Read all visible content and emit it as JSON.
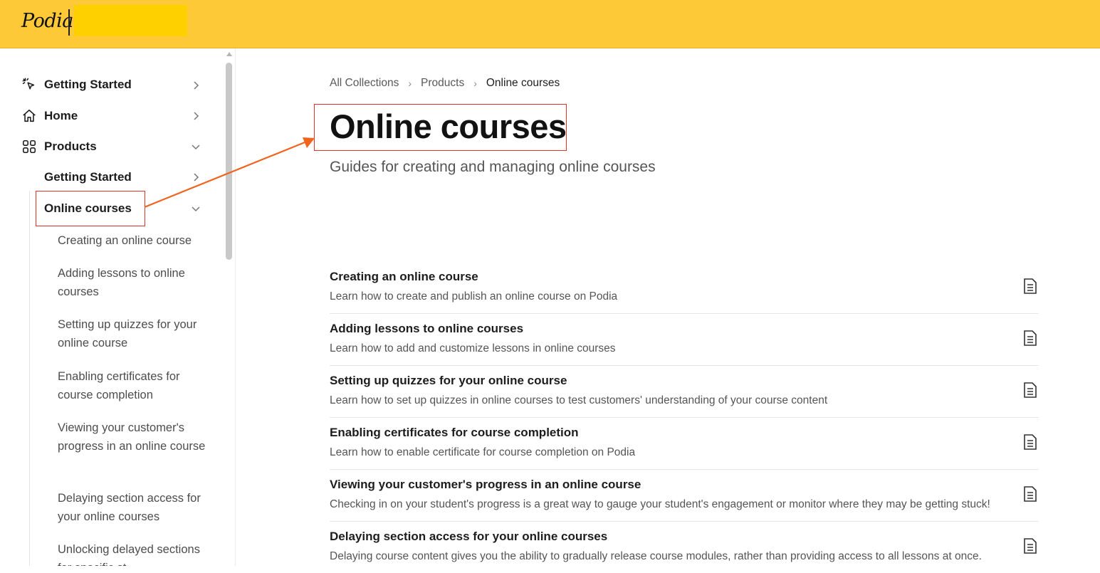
{
  "header": {
    "logo_text": "Podia",
    "brand_color": "#fdc936"
  },
  "sidebar": {
    "items": [
      {
        "label": "Getting Started",
        "icon": "cursor-click-icon",
        "chevron": "chevron-right-icon"
      },
      {
        "label": "Home",
        "icon": "home-icon",
        "chevron": "chevron-right-icon"
      },
      {
        "label": "Products",
        "icon": "grid-icon",
        "chevron": "chevron-down-icon"
      }
    ],
    "products_children": [
      {
        "label": "Getting Started",
        "chevron": "chevron-right-icon"
      },
      {
        "label": "Online courses",
        "chevron": "chevron-down-icon",
        "active": true
      }
    ],
    "course_articles": [
      "Creating an online course",
      "Adding lessons to online courses",
      "Setting up quizzes for your online course",
      "Enabling certificates for course completion",
      "Viewing your customer's progress in an online course",
      "Delaying section access for your online courses",
      "Unlocking delayed sections for specific st"
    ]
  },
  "breadcrumb": {
    "items": [
      "All Collections",
      "Products",
      "Online courses"
    ],
    "separator": "›"
  },
  "page": {
    "title": "Online courses",
    "subtitle": "Guides for creating and managing online courses"
  },
  "articles": [
    {
      "title": "Creating an online course",
      "description": "Learn how to create and publish an online course on Podia",
      "icon": "document-icon"
    },
    {
      "title": "Adding lessons to online courses",
      "description": "Learn how to add and customize lessons in online courses",
      "icon": "document-icon"
    },
    {
      "title": "Setting up quizzes for your online course",
      "description": "Learn how to set up quizzes in online courses to test customers' understanding of your course content",
      "icon": "document-icon"
    },
    {
      "title": "Enabling certificates for course completion",
      "description": "Learn how to enable certificate for course completion on Podia",
      "icon": "document-icon"
    },
    {
      "title": "Viewing your customer's progress in an online course",
      "description": "Checking in on your student's progress is a great way to gauge your student's engagement or monitor where they may be getting stuck!",
      "icon": "document-icon"
    },
    {
      "title": "Delaying section access for your online courses",
      "description": "Delaying course content gives you the ability to gradually release course modules, rather than providing access to all lessons at once.",
      "icon": "document-icon"
    }
  ],
  "annotation": {
    "highlight_color": "#e0322b",
    "arrow_color": "#f0641e"
  }
}
